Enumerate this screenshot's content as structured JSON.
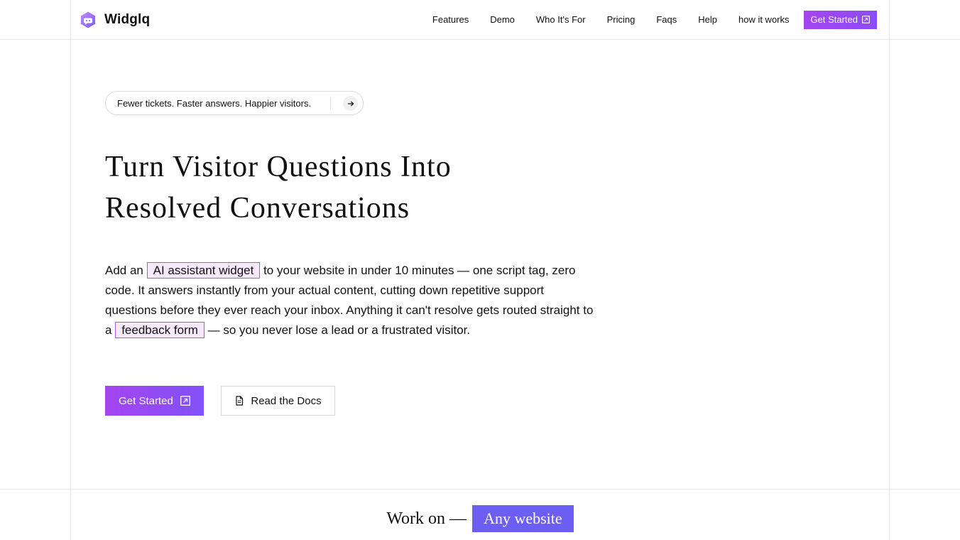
{
  "brand": {
    "name": "Widglq"
  },
  "nav": {
    "links": [
      "Features",
      "Demo",
      "Who It's For",
      "Pricing",
      "Faqs",
      "Help",
      "how it works"
    ],
    "cta_label": "Get Started"
  },
  "hero": {
    "pill_text": "Fewer tickets. Faster answers. Happier visitors.",
    "headline_line1": "Turn Visitor Questions Into",
    "headline_line2": "Resolved Conversations",
    "lead_part1": "Add an ",
    "lead_highlight1": "AI assistant widget",
    "lead_part2": " to your website in under 10 minutes — one script tag, zero code. It answers instantly from your actual content, cutting down repetitive support questions before they ever reach your inbox. Anything it can't resolve gets routed straight to a ",
    "lead_highlight2": "feedback form",
    "lead_part3": " — so you never lose a lead or a frustrated visitor.",
    "primary_button": "Get Started",
    "secondary_button": "Read the Docs"
  },
  "work": {
    "prefix": "Work on —",
    "badge": "Any website"
  },
  "colors": {
    "accent_purple": "#a445f0",
    "accent_violet": "#6d5ef3",
    "highlight_bg": "#f6e9fb",
    "highlight_border": "#b155d6"
  },
  "icons": {
    "logo": "widget-logo-icon",
    "external": "external-link-icon",
    "arrow": "arrow-right-icon",
    "doc": "document-icon"
  }
}
